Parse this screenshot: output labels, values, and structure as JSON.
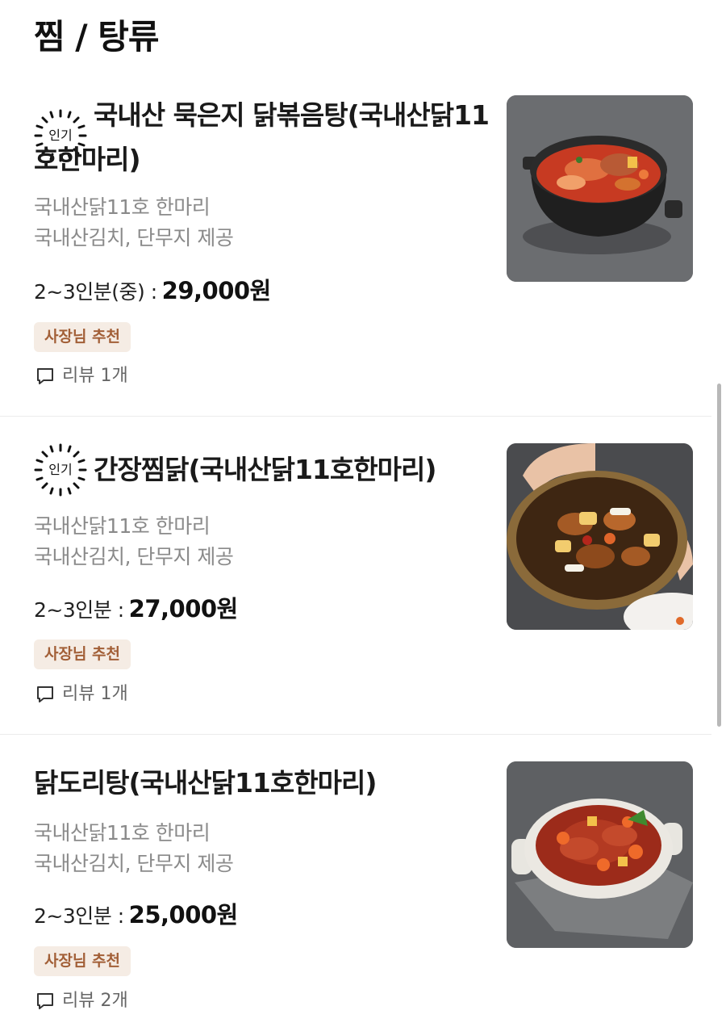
{
  "section": {
    "title": "찜 / 탕류"
  },
  "items": [
    {
      "badge": "인기",
      "name": "국내산 묵은지 닭볶음탕(국내산닭11호한마리)",
      "desc_lines": [
        "국내산닭11호 한마리",
        "국내산김치, 단무지 제공"
      ],
      "price_label": "2~3인분(중) :",
      "price": "29,000원",
      "tag": "사장님 추천",
      "reviews": "리뷰 1개"
    },
    {
      "badge": "인기",
      "name": "간장찜닭(국내산닭11호한마리)",
      "desc_lines": [
        "국내산닭11호 한마리",
        "국내산김치, 단무지 제공"
      ],
      "price_label": "2~3인분 :",
      "price": "27,000원",
      "tag": "사장님 추천",
      "reviews": "리뷰 1개"
    },
    {
      "badge": "",
      "name": "닭도리탕(국내산닭11호한마리)",
      "desc_lines": [
        "국내산닭11호 한마리",
        "국내산김치, 단무지 제공"
      ],
      "price_label": "2~3인분 :",
      "price": "25,000원",
      "tag": "사장님 추천",
      "reviews": "리뷰 2개"
    }
  ],
  "icons": {
    "review": "speech-bubble-icon",
    "badge": "sparkle-ring-icon"
  },
  "colors": {
    "tag_bg": "#f5ece4",
    "tag_text": "#a25f37",
    "desc_text": "#8a8a8a"
  }
}
